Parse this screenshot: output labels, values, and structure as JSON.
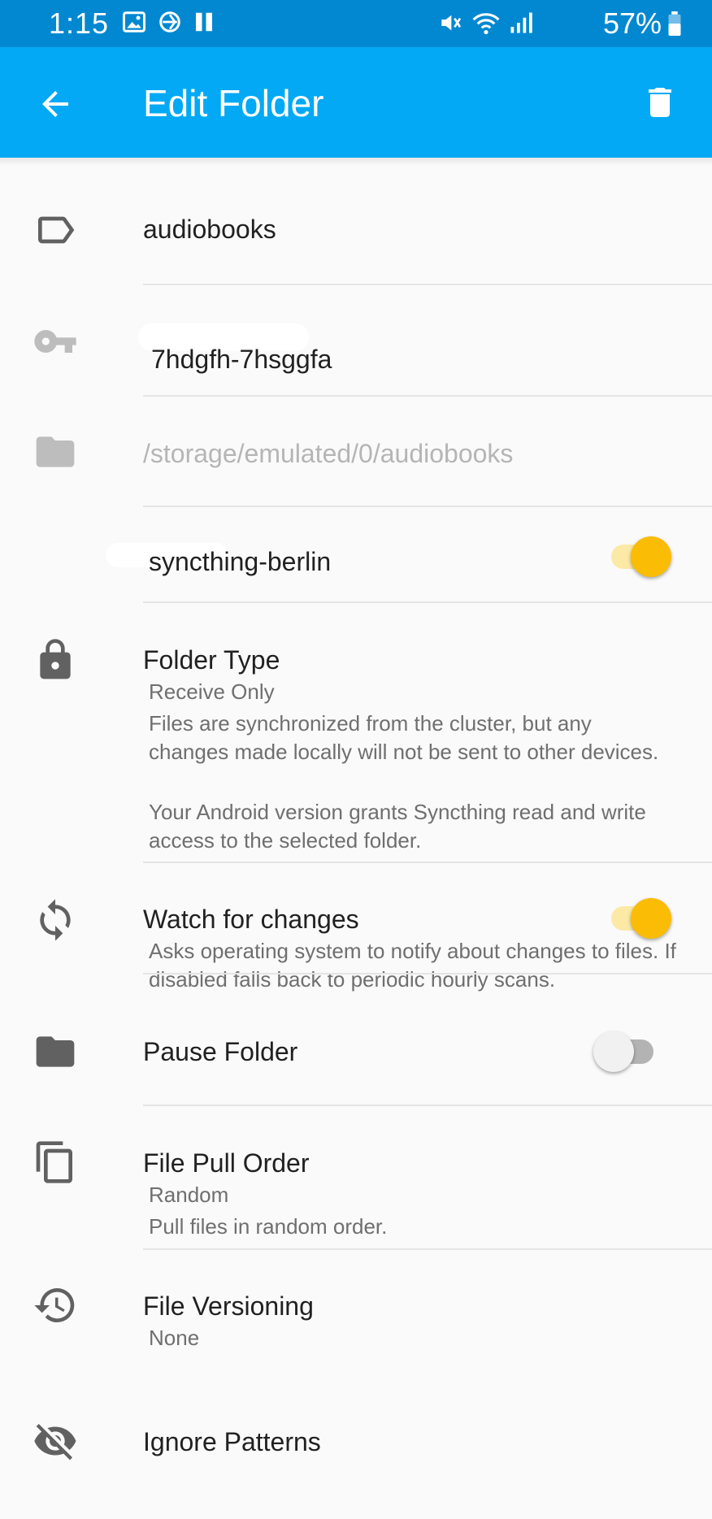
{
  "status_bar": {
    "time": "1:15",
    "battery_percent": "57%"
  },
  "app_bar": {
    "title": "Edit Folder",
    "back_icon": "arrow-back-icon",
    "delete_icon": "trash-icon"
  },
  "fields": {
    "label": {
      "icon": "label-icon",
      "value": "audiobooks"
    },
    "id": {
      "icon": "key-icon",
      "value": "7hdgfh-7hsggfa"
    },
    "path": {
      "icon": "folder-icon",
      "placeholder": "/storage/emulated/0/audiobooks"
    }
  },
  "device": {
    "name": "syncthing-berlin",
    "enabled": true
  },
  "folder_type": {
    "title": "Folder Type",
    "value": "Receive Only",
    "description": "Files are synchronized from the cluster, but any changes made locally will not be sent to other devices.",
    "note": "Your Android version grants Syncthing read and write access to the selected folder."
  },
  "watch": {
    "title": "Watch for changes",
    "description": "Asks operating system to notify about changes to files. If disabled falls back to periodic hourly scans.",
    "enabled": true
  },
  "pause": {
    "title": "Pause Folder",
    "enabled": false
  },
  "pull_order": {
    "title": "File Pull Order",
    "value": "Random",
    "description": "Pull files in random order."
  },
  "versioning": {
    "title": "File Versioning",
    "value": "None"
  },
  "ignore": {
    "title": "Ignore Patterns"
  },
  "colors": {
    "status_bar": "#0288d1",
    "app_bar": "#03a9f4",
    "accent": "#fbbc05",
    "icon_gray": "#616161"
  }
}
